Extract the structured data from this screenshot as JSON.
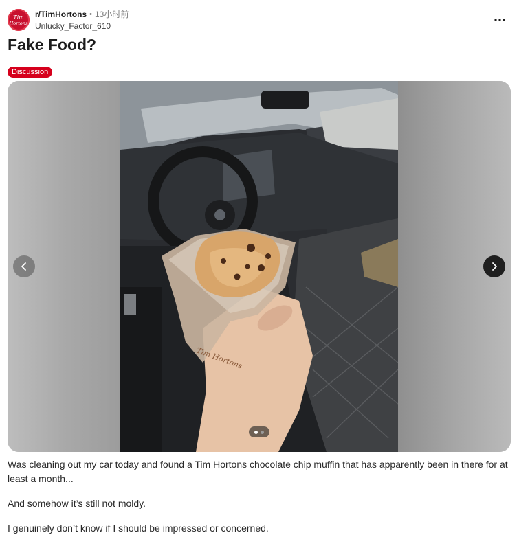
{
  "post": {
    "subreddit": "r/TimHortons",
    "separator": "•",
    "time": "13小时前",
    "author": "Unlucky_Factor_610",
    "title": "Fake Food?",
    "flair": "Discussion",
    "paragraphs": [
      "Was cleaning out my car today and found a Tim Hortons chocolate chip muffin that has apparently been in there for at least a month...",
      "And somehow it’s still not moldy.",
      "I genuinely don’t know if I should be impressed or concerned."
    ]
  },
  "avatar": {
    "text": "Tim Hortons",
    "color": "#c8102e"
  },
  "media": {
    "image_description_icon": "photo",
    "prev_icon": "chevron-left-icon",
    "next_icon": "chevron-right-icon",
    "page_count": 2,
    "current_page": 1
  },
  "colors": {
    "flair": "#d6001c",
    "brand": "#c8102e"
  }
}
